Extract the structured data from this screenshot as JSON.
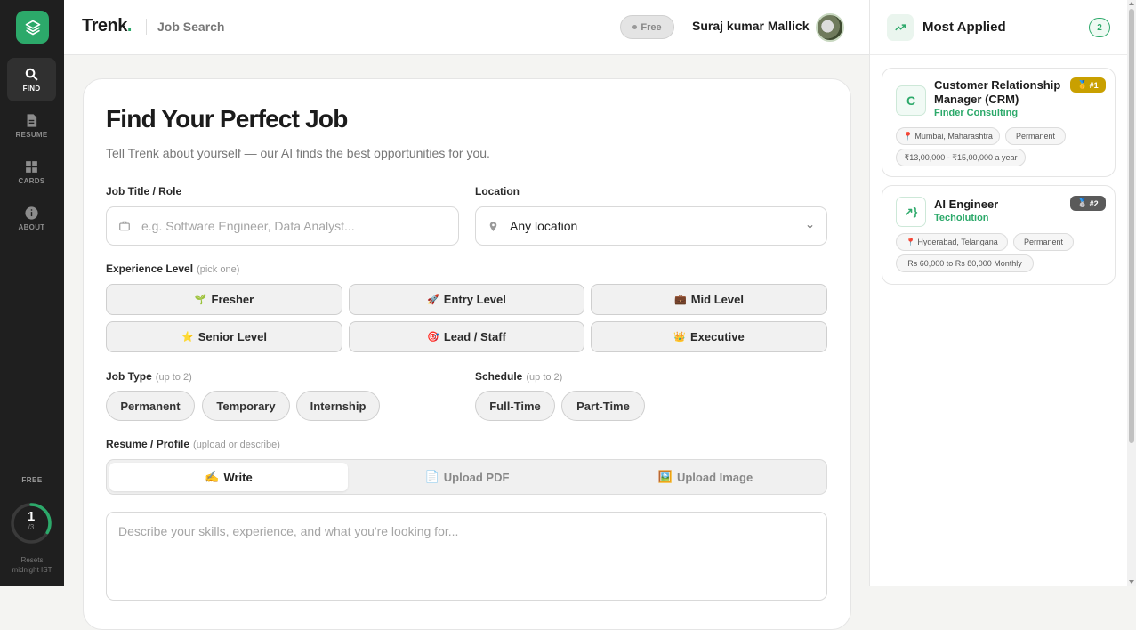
{
  "nav": {
    "items": [
      {
        "label": "FIND",
        "icon": "search-icon"
      },
      {
        "label": "RESUME",
        "icon": "document-icon"
      },
      {
        "label": "CARDS",
        "icon": "grid-icon"
      },
      {
        "label": "ABOUT",
        "icon": "info-icon"
      }
    ],
    "plan": "FREE",
    "usage_used": "1",
    "usage_total": "/3",
    "usage_fraction": 0.333,
    "resets_line1": "Resets",
    "resets_line2": "midnight IST"
  },
  "header": {
    "brand": "Trenk",
    "brand_dot": ".",
    "breadcrumb": "Job Search",
    "plan_badge": "Free",
    "user_name": "Suraj kumar Mallick"
  },
  "form": {
    "title": "Find Your Perfect Job",
    "subtitle": "Tell Trenk about yourself — our AI finds the best opportunities for you.",
    "job_title_label": "Job Title / Role",
    "job_title_placeholder": "e.g. Software Engineer, Data Analyst...",
    "location_label": "Location",
    "location_value": "Any location",
    "experience_label": "Experience Level",
    "experience_hint": "(pick one)",
    "experience_options": [
      {
        "emoji": "🌱",
        "label": "Fresher"
      },
      {
        "emoji": "🚀",
        "label": "Entry Level"
      },
      {
        "emoji": "💼",
        "label": "Mid Level"
      },
      {
        "emoji": "⭐",
        "label": "Senior Level"
      },
      {
        "emoji": "🎯",
        "label": "Lead / Staff"
      },
      {
        "emoji": "👑",
        "label": "Executive"
      }
    ],
    "job_type_label": "Job Type",
    "job_type_hint": "(up to 2)",
    "job_types": [
      "Permanent",
      "Temporary",
      "Internship"
    ],
    "schedule_label": "Schedule",
    "schedule_hint": "(up to 2)",
    "schedules": [
      "Full-Time",
      "Part-Time"
    ],
    "resume_label": "Resume / Profile",
    "resume_hint": "(upload or describe)",
    "resume_tabs": [
      {
        "emoji": "✍️",
        "label": "Write"
      },
      {
        "emoji": "📄",
        "label": "Upload PDF"
      },
      {
        "emoji": "🖼️",
        "label": "Upload Image"
      }
    ],
    "resume_placeholder": "Describe your skills, experience, and what you're looking for..."
  },
  "sidebar": {
    "title": "Most Applied",
    "count": "2",
    "jobs": [
      {
        "logo": "C",
        "title_line1": "Customer Relationship",
        "title_line2": "Manager (CRM)",
        "company": "Finder Consulting",
        "rank_emoji": "🥇",
        "rank": "#1",
        "location": "Mumbai, Maharashtra",
        "type": "Permanent",
        "salary": "₹13,00,000 - ₹15,00,000 a year"
      },
      {
        "logo": "↗}",
        "title_line1": "AI Engineer",
        "company": "Techolution",
        "rank_emoji": "🥈",
        "rank": "#2",
        "location": "Hyderabad, Telangana",
        "type": "Permanent",
        "salary": "Rs 60,000 to Rs 80,000 Monthly"
      }
    ]
  },
  "colors": {
    "accent": "#2ca96a",
    "rail": "#1f1f1f",
    "gold": "#c9a000",
    "silver": "#5a5a5a"
  }
}
